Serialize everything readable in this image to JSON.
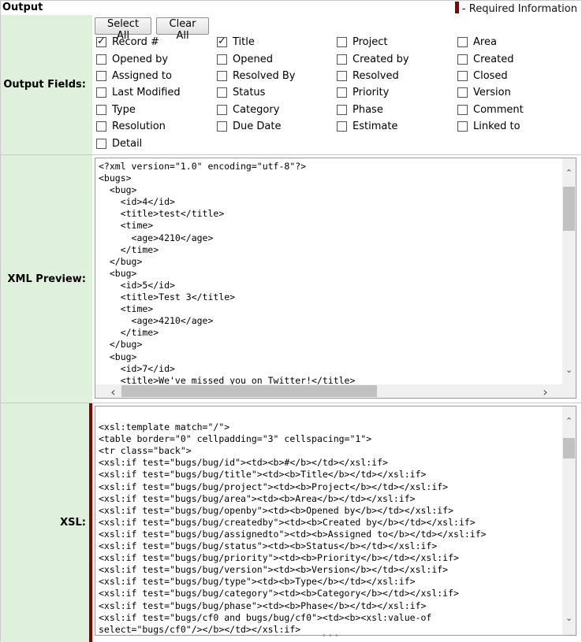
{
  "header": {
    "title": "Output",
    "required_info": "- Required Information"
  },
  "output_fields": {
    "label": "Output Fields:",
    "select_all": "Select All",
    "clear_all": "Clear All",
    "fields": [
      {
        "label": "Record #",
        "checked": true
      },
      {
        "label": "Title",
        "checked": true
      },
      {
        "label": "Project",
        "checked": false
      },
      {
        "label": "Area",
        "checked": false
      },
      {
        "label": "Opened by",
        "checked": false
      },
      {
        "label": "Opened",
        "checked": false
      },
      {
        "label": "Created by",
        "checked": false
      },
      {
        "label": "Created",
        "checked": false
      },
      {
        "label": "Assigned to",
        "checked": false
      },
      {
        "label": "Resolved By",
        "checked": false
      },
      {
        "label": "Resolved",
        "checked": false
      },
      {
        "label": "Closed",
        "checked": false
      },
      {
        "label": "Last Modified",
        "checked": false
      },
      {
        "label": "Status",
        "checked": false
      },
      {
        "label": "Priority",
        "checked": false
      },
      {
        "label": "Version",
        "checked": false
      },
      {
        "label": "Type",
        "checked": false
      },
      {
        "label": "Category",
        "checked": false
      },
      {
        "label": "Phase",
        "checked": false
      },
      {
        "label": "Comment",
        "checked": false
      },
      {
        "label": "Resolution",
        "checked": false
      },
      {
        "label": "Due Date",
        "checked": false
      },
      {
        "label": "Estimate",
        "checked": false
      },
      {
        "label": "Linked to",
        "checked": false
      },
      {
        "label": "Detail",
        "checked": false
      }
    ]
  },
  "xml_preview": {
    "label": "XML Preview:",
    "text": "<?xml version=\"1.0\" encoding=\"utf-8\"?>\n<bugs>\n  <bug>\n    <id>4</id>\n    <title>test</title>\n    <time>\n      <age>4210</age>\n    </time>\n  </bug>\n  <bug>\n    <id>5</id>\n    <title>Test 3</title>\n    <time>\n      <age>4210</age>\n    </time>\n  </bug>\n  <bug>\n    <id>7</id>\n    <title>We've missed you on Twitter!</title>"
  },
  "xsl": {
    "label": "XSL:",
    "text": "\n<xsl:template match=\"/\">\n<table border=\"0\" cellpadding=\"3\" cellspacing=\"1\">\n<tr class=\"back\">\n<xsl:if test=\"bugs/bug/id\"><td><b>#</b></td></xsl:if>\n<xsl:if test=\"bugs/bug/title\"><td><b>Title</b></td></xsl:if>\n<xsl:if test=\"bugs/bug/project\"><td><b>Project</b></td></xsl:if>\n<xsl:if test=\"bugs/bug/area\"><td><b>Area</b></td></xsl:if>\n<xsl:if test=\"bugs/bug/openby\"><td><b>Opened by</b></td></xsl:if>\n<xsl:if test=\"bugs/bug/createdby\"><td><b>Created by</b></td></xsl:if>\n<xsl:if test=\"bugs/bug/assignedto\"><td><b>Assigned to</b></td></xsl:if>\n<xsl:if test=\"bugs/bug/status\"><td><b>Status</b></td></xsl:if>\n<xsl:if test=\"bugs/bug/priority\"><td><b>Priority</b></td></xsl:if>\n<xsl:if test=\"bugs/bug/version\"><td><b>Version</b></td></xsl:if>\n<xsl:if test=\"bugs/bug/type\"><td><b>Type</b></td></xsl:if>\n<xsl:if test=\"bugs/bug/category\"><td><b>Category</b></td></xsl:if>\n<xsl:if test=\"bugs/bug/phase\"><td><b>Phase</b></td></xsl:if>\n<xsl:if test=\"bugs/cf0 and bugs/bug/cf0\"><td><b><xsl:value-of\nselect=\"bugs/cf0\"/></b></td></xsl:if>"
  },
  "colors": {
    "label_bg": "#dff0dc",
    "required_marker": "#8b0000"
  }
}
